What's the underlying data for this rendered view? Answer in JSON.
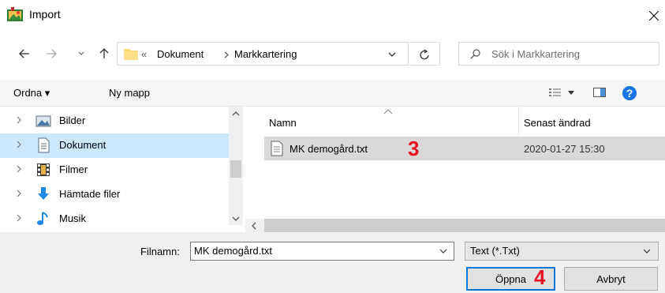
{
  "window": {
    "title": "Import"
  },
  "address": {
    "overflow": "«",
    "crumbs": [
      "Dokument",
      "Markkartering"
    ]
  },
  "search": {
    "placeholder": "Sök i Markkartering"
  },
  "toolbar": {
    "organize": "Ordna ▾",
    "new_folder": "Ny mapp"
  },
  "nav": {
    "items": [
      {
        "label": "Bilder",
        "icon": "pictures-icon"
      },
      {
        "label": "Dokument",
        "icon": "documents-icon",
        "selected": true
      },
      {
        "label": "Filmer",
        "icon": "videos-icon"
      },
      {
        "label": "Hämtade filer",
        "icon": "downloads-icon"
      },
      {
        "label": "Musik",
        "icon": "music-icon"
      }
    ]
  },
  "list": {
    "columns": [
      "Namn",
      "Senast ändrad"
    ],
    "files": [
      {
        "name": "MK demogård.txt",
        "modified": "2020-01-27 15:30"
      }
    ]
  },
  "annotations": {
    "marker_file": "3",
    "marker_open": "4"
  },
  "footer": {
    "filename_label": "Filnamn:",
    "filename_value": "MK demogård.txt",
    "filetype_value": "Text (*.Txt)",
    "open_label": "Öppna",
    "cancel_label": "Avbryt"
  },
  "colors": {
    "accent": "#0078d7",
    "selection": "#cce8ff",
    "marker": "#e81123",
    "help": "#1a73e8"
  }
}
